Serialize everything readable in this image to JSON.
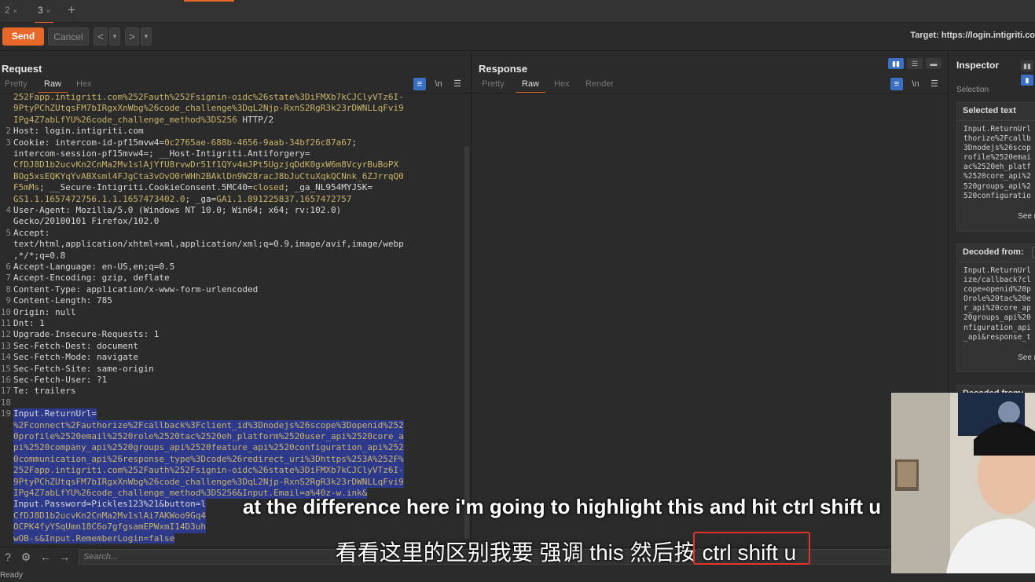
{
  "tabs": [
    {
      "label": "2",
      "close": "×"
    },
    {
      "label": "3",
      "close": "×"
    }
  ],
  "toolbar": {
    "send": "Send",
    "cancel": "Cancel",
    "back": "<",
    "back_menu": "▾",
    "forward": ">",
    "forward_menu": "▾",
    "target": "Target: https://login.intigriti.co"
  },
  "request": {
    "title": "Request",
    "subtabs": [
      "Pretty",
      "Raw",
      "Hex"
    ],
    "active_subtab": "Raw",
    "lines": [
      {
        "n": "",
        "segments": [
          {
            "t": "252Fapp.intigriti.com%252Fauth%252Fsignin-oidc%26state%3DiFMXb7kCJClyVTz6I-",
            "c": "url"
          }
        ]
      },
      {
        "n": "",
        "segments": [
          {
            "t": "9PtyPChZUtqsFM7bIRgxXnWbg%26code_challenge%3DqL2Njp-RxnS2RgR3k23rDWNLLqFvi9",
            "c": "url"
          }
        ]
      },
      {
        "n": "",
        "segments": [
          {
            "t": "IPg4Z7abLfYU%26code_challenge_method%3DS256",
            "c": "url"
          },
          {
            "t": " HTTP/2",
            "c": "key"
          }
        ]
      },
      {
        "n": "2",
        "segments": [
          {
            "t": "Host: login.intigriti.com",
            "c": "key"
          }
        ]
      },
      {
        "n": "3",
        "segments": [
          {
            "t": "Cookie: intercom-id-pf15mvw4=",
            "c": "key"
          },
          {
            "t": "0c2765ae-688b-4656-9aab-34bf26c87a67",
            "c": "val"
          },
          {
            "t": ";",
            "c": "key"
          }
        ]
      },
      {
        "n": "",
        "segments": [
          {
            "t": "intercom-session-pf15mvw4=; __Host-Intigriti.Antiforgery=",
            "c": "key"
          }
        ]
      },
      {
        "n": "",
        "segments": [
          {
            "t": "CfDJ8D1b2ucvKn2CnMa2Mv1slAjYfU8rvwDr51f1QYv4mJPt5UgzjqDdK0gxW6m8VcyrBuBoPX",
            "c": "val"
          }
        ]
      },
      {
        "n": "",
        "segments": [
          {
            "t": "BOg5xsEQKYqYvABXsml4FJgCta3vOvO0rWHh2BAklDn9W28racJ8bJuCtuXqkQCNnk_6ZJrrqQ0",
            "c": "val"
          }
        ]
      },
      {
        "n": "",
        "segments": [
          {
            "t": "F5mMs",
            "c": "val"
          },
          {
            "t": "; __Secure-Intigriti.CookieConsent.5MC40=",
            "c": "key"
          },
          {
            "t": "closed",
            "c": "val"
          },
          {
            "t": "; _ga_NL954MYJSK=",
            "c": "key"
          }
        ]
      },
      {
        "n": "",
        "segments": [
          {
            "t": "GS1.1.1657472756.1.1.1657473402.0",
            "c": "val"
          },
          {
            "t": "; _ga=",
            "c": "key"
          },
          {
            "t": "GA1.1.891225837.1657472757",
            "c": "val"
          }
        ]
      },
      {
        "n": "4",
        "segments": [
          {
            "t": "User-Agent: Mozilla/5.0 (Windows NT 10.0; Win64; x64; rv:102.0)",
            "c": "key"
          }
        ]
      },
      {
        "n": "",
        "segments": [
          {
            "t": "Gecko/20100101 Firefox/102.0",
            "c": "key"
          }
        ]
      },
      {
        "n": "5",
        "segments": [
          {
            "t": "Accept:",
            "c": "key"
          }
        ]
      },
      {
        "n": "",
        "segments": [
          {
            "t": "text/html,application/xhtml+xml,application/xml;q=0.9,image/avif,image/webp",
            "c": "key"
          }
        ]
      },
      {
        "n": "",
        "segments": [
          {
            "t": ",*/*;q=0.8",
            "c": "key"
          }
        ]
      },
      {
        "n": "6",
        "segments": [
          {
            "t": "Accept-Language: en-US,en;q=0.5",
            "c": "key"
          }
        ]
      },
      {
        "n": "7",
        "segments": [
          {
            "t": "Accept-Encoding: gzip, deflate",
            "c": "key"
          }
        ]
      },
      {
        "n": "8",
        "segments": [
          {
            "t": "Content-Type: application/x-www-form-urlencoded",
            "c": "key"
          }
        ]
      },
      {
        "n": "9",
        "segments": [
          {
            "t": "Content-Length: 785",
            "c": "key"
          }
        ]
      },
      {
        "n": "10",
        "segments": [
          {
            "t": "Origin: null",
            "c": "key"
          }
        ]
      },
      {
        "n": "11",
        "segments": [
          {
            "t": "Dnt: 1",
            "c": "key"
          }
        ]
      },
      {
        "n": "12",
        "segments": [
          {
            "t": "Upgrade-Insecure-Requests: 1",
            "c": "key"
          }
        ]
      },
      {
        "n": "13",
        "segments": [
          {
            "t": "Sec-Fetch-Dest: document",
            "c": "key"
          }
        ]
      },
      {
        "n": "14",
        "segments": [
          {
            "t": "Sec-Fetch-Mode: navigate",
            "c": "key"
          }
        ]
      },
      {
        "n": "15",
        "segments": [
          {
            "t": "Sec-Fetch-Site: same-origin",
            "c": "key"
          }
        ]
      },
      {
        "n": "16",
        "segments": [
          {
            "t": "Sec-Fetch-User: ?1",
            "c": "key"
          }
        ]
      },
      {
        "n": "17",
        "segments": [
          {
            "t": "Te: trailers",
            "c": "key"
          }
        ]
      },
      {
        "n": "18",
        "segments": [
          {
            "t": "",
            "c": "key"
          }
        ]
      },
      {
        "n": "19",
        "selected": true,
        "segments": [
          {
            "t": "Input.ReturnUrl=",
            "c": "key"
          }
        ]
      },
      {
        "n": "",
        "selected": true,
        "segments": [
          {
            "t": "%2Fconnect%2Fauthorize%2Fcallback%3Fclient_id%3Dnodejs%26scope%3Dopenid%252",
            "c": "val"
          }
        ]
      },
      {
        "n": "",
        "selected": true,
        "segments": [
          {
            "t": "0profile%2520email%2520role%2520tac%2520eh_platform%2520user_api%2520core_a",
            "c": "val"
          }
        ]
      },
      {
        "n": "",
        "selected": true,
        "segments": [
          {
            "t": "pi%2520company_api%2520groups_api%2520feature_api%2520configuration_api%252",
            "c": "val"
          }
        ]
      },
      {
        "n": "",
        "selected": true,
        "segments": [
          {
            "t": "0communication_api%26response_type%3Dcode%26redirect_uri%3Dhttps%253A%252F%",
            "c": "val"
          }
        ]
      },
      {
        "n": "",
        "selected": true,
        "segments": [
          {
            "t": "252Fapp.intigriti.com%252Fauth%252Fsignin-oidc%26state%3DiFMXb7kCJClyVTz6I-",
            "c": "val"
          }
        ]
      },
      {
        "n": "",
        "selected": true,
        "segments": [
          {
            "t": "9PtyPChZUtqsFM7bIRgxXnWbg%26code_challenge%3DqL2Njp-RxnS2RgR3k23rDWNLLqFvi9",
            "c": "val"
          }
        ]
      },
      {
        "n": "",
        "selected": true,
        "segments": [
          {
            "t": "IPg4Z7abLfYU%26code_challenge_method%3DS256&Input.Email=a%40z-w.ink&",
            "c": "val"
          }
        ]
      },
      {
        "n": "",
        "selected": true,
        "segments": [
          {
            "t": "Input.Password=Pickles123%21&button=l",
            "c": "key"
          }
        ]
      },
      {
        "n": "",
        "selected": true,
        "segments": [
          {
            "t": "CfDJ8D1b2ucvKn2CnMa2Mv1slAi7AKWoo9Gq4",
            "c": "val"
          }
        ]
      },
      {
        "n": "",
        "selected": true,
        "segments": [
          {
            "t": "OCPK4fyYSqUmn18C6o7gfgsamEPWxmI14D3uh",
            "c": "val"
          }
        ]
      },
      {
        "n": "",
        "selected": true,
        "segments": [
          {
            "t": "wOB-s&Input.RememberLogin=false",
            "c": "val"
          }
        ]
      }
    ]
  },
  "response": {
    "title": "Response",
    "subtabs": [
      "Pretty",
      "Raw",
      "Hex",
      "Render"
    ],
    "active_subtab": "Raw"
  },
  "inspector": {
    "title": "Inspector",
    "selection_label": "Selection",
    "selected_text": {
      "header": "Selected text",
      "body": "Input.ReturnUrl\nthorize%2Fcallb\n3Dnodejs%26scop\nrofile%2520emai\nac%2520eh_platf\n%2520core_api%2\n520groups_api%2\n520configuratio",
      "see_more": "See m"
    },
    "decoded_from": {
      "header": "Decoded from:",
      "chip": "U",
      "body": "Input.ReturnUrl\nize/callback?cl\ncope=openid%20p\nOrole%20tac%20e\nr_api%20core_ap\n20groups_api%20\nnfiguration_api\n_api&response_t",
      "see_more": "See m"
    },
    "next_header": "Decoded from:"
  },
  "footer": {
    "search_placeholder": "Search...",
    "status": "Ready"
  },
  "subtitles": {
    "english": "at the difference here i'm going to highlight this and hit ctrl shift u",
    "chinese": "看看这里的区别我要 强调 this 然后按 ctrl shift u"
  },
  "colors": {
    "accent": "#e8682a",
    "selection": "#2d3a8c",
    "toggle_on": "#3a6fc4",
    "highlight_box": "#e0342c"
  }
}
